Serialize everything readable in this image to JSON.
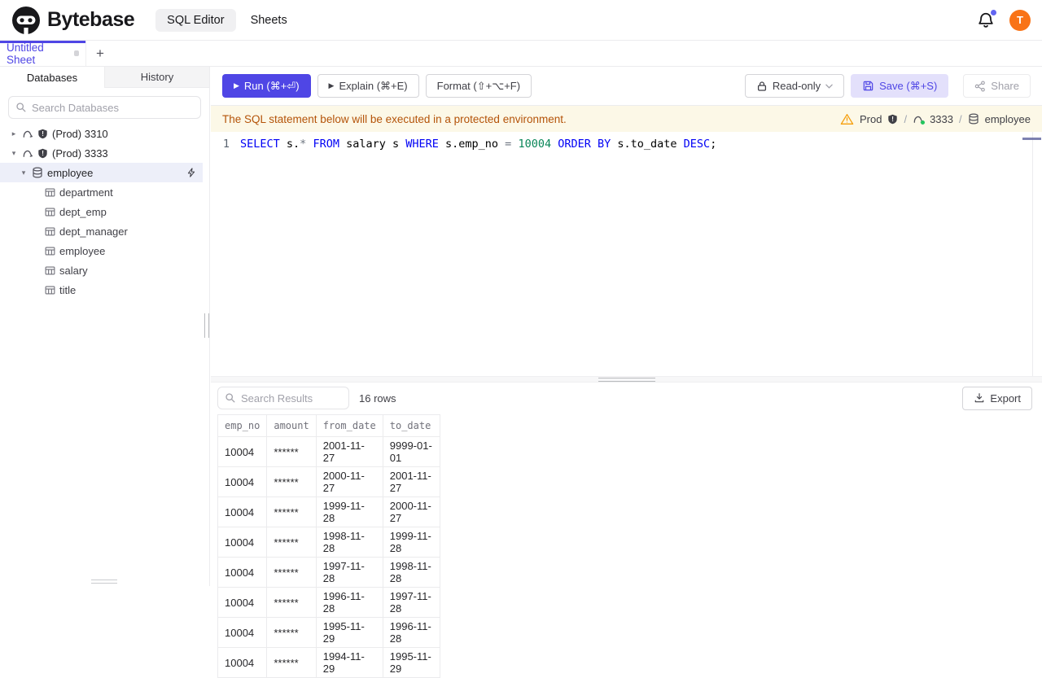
{
  "header": {
    "brand": "Bytebase",
    "nav_sql_editor": "SQL Editor",
    "nav_sheets": "Sheets",
    "avatar_initial": "T"
  },
  "sheet_tab": {
    "title": "Untitled Sheet",
    "add": "+"
  },
  "icons": {
    "caret_collapsed": "▸",
    "caret_expanded": "▾",
    "play": "▶"
  },
  "sidebar": {
    "tab_databases": "Databases",
    "tab_history": "History",
    "search_placeholder": "Search Databases",
    "instances": [
      {
        "label": "(Prod) 3310"
      },
      {
        "label": "(Prod) 3333"
      }
    ],
    "database": {
      "label": "employee"
    },
    "tables": [
      "department",
      "dept_emp",
      "dept_manager",
      "employee",
      "salary",
      "title"
    ]
  },
  "toolbar": {
    "run": "Run (⌘+⏎)",
    "explain": "Explain (⌘+E)",
    "format": "Format (⇧+⌥+F)",
    "readonly": "Read-only",
    "save": "Save (⌘+S)",
    "share": "Share"
  },
  "banner": {
    "message": "The SQL statement below will be executed in a protected environment.",
    "env": "Prod",
    "separator": "/",
    "instance": "3333",
    "database": "employee"
  },
  "editor": {
    "line_number": "1",
    "tokens": {
      "t0": "SELECT",
      "t1": " s.",
      "t2": "*",
      "t3": " ",
      "t4": "FROM",
      "t5": " salary s ",
      "t6": "WHERE",
      "t7": " s.emp_no ",
      "t8": "=",
      "t9": " ",
      "t10": "10004",
      "t11": " ",
      "t12": "ORDER BY",
      "t13": " s.to_date ",
      "t14": "DESC",
      "t15": ";"
    }
  },
  "results": {
    "search_placeholder": "Search Results",
    "row_count": "16 rows",
    "export": "Export",
    "columns": [
      "emp_no",
      "amount",
      "from_date",
      "to_date"
    ],
    "rows": [
      [
        "10004",
        "******",
        "2001-11-27",
        "9999-01-01"
      ],
      [
        "10004",
        "******",
        "2000-11-27",
        "2001-11-27"
      ],
      [
        "10004",
        "******",
        "1999-11-28",
        "2000-11-27"
      ],
      [
        "10004",
        "******",
        "1998-11-28",
        "1999-11-28"
      ],
      [
        "10004",
        "******",
        "1997-11-28",
        "1998-11-28"
      ],
      [
        "10004",
        "******",
        "1996-11-28",
        "1997-11-28"
      ],
      [
        "10004",
        "******",
        "1995-11-29",
        "1996-11-28"
      ],
      [
        "10004",
        "******",
        "1994-11-29",
        "1995-11-29"
      ]
    ]
  },
  "colors": {
    "accent": "#4f46e5",
    "avatar": "#f97316",
    "warning_bg": "#fcf8e7",
    "warning_text": "#b45309",
    "sql_keyword": "#0000f5",
    "sql_number": "#098658"
  }
}
